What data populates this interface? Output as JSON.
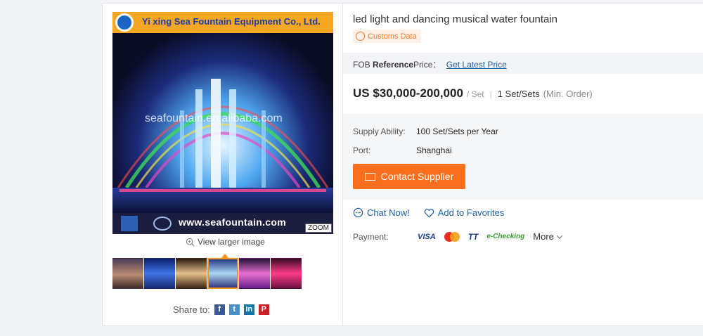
{
  "product": {
    "title": "led light and dancing musical water fountain",
    "customs_badge": "Customs Data"
  },
  "image": {
    "banner_company": "Yi xing Sea Fountain Equipment Co., Ltd.",
    "watermark": "seafountain.en.alibaba.com",
    "strip_url": "www.seafountain.com",
    "zoom_label": "ZOOM",
    "view_larger": "View larger image",
    "thumbnail_count": 6,
    "active_thumbnail": 4
  },
  "share": {
    "label": "Share to:",
    "networks": [
      "facebook",
      "twitter",
      "linkedin",
      "pinterest"
    ]
  },
  "pricing": {
    "fob_prefix": "FOB",
    "fob_reference": "Reference",
    "fob_suffix": "Price：",
    "get_latest_price": "Get Latest Price",
    "price": "US $30,000-200,000",
    "unit": "/ Set",
    "min_order_qty": "1 Set/Sets",
    "min_order_note": "(Min. Order)"
  },
  "attributes": [
    {
      "label": "Supply Ability:",
      "value": "100 Set/Sets per Year"
    },
    {
      "label": "Port:",
      "value": "Shanghai"
    }
  ],
  "actions": {
    "contact_supplier": "Contact Supplier",
    "chat_now": "Chat Now!",
    "add_favorites": "Add to Favorites"
  },
  "payment": {
    "label": "Payment:",
    "methods": [
      "VISA",
      "Mastercard",
      "TT",
      "e-Checking"
    ],
    "more": "More"
  },
  "colors": {
    "accent_orange": "#f96f1f",
    "link_blue": "#1f5fa8",
    "customs_orange": "#ef7d2a"
  }
}
